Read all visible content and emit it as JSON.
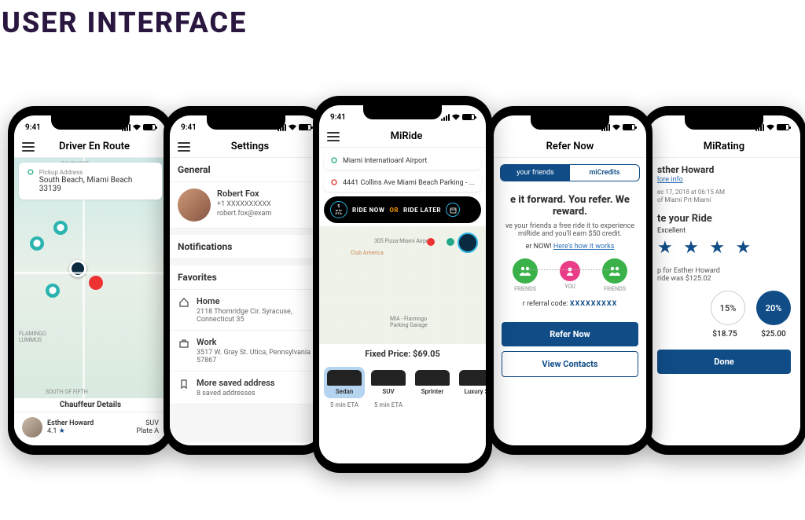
{
  "heading": "USER INTERFACE",
  "status": {
    "time": "9:41"
  },
  "p1": {
    "title": "Driver En Route",
    "pickup_label": "Pickup Address",
    "pickup_value": "South Beach, Miami Beach 33139",
    "chauffeur_title": "Chauffeur Details",
    "driver_name": "Esther Howard",
    "rating": "4.1",
    "veh": "SUV",
    "plate": "Plate A"
  },
  "p2": {
    "title": "Settings",
    "general": "General",
    "user_name": "Robert Fox",
    "user_phone": "+1 XXXXXXXXXX",
    "user_email": "robert.fox@exam",
    "notifications": "Notifications",
    "favorites": "Favorites",
    "home": "Home",
    "home_addr": "2118 Thornridge Cir. Syracuse, Connecticut 35",
    "work": "Work",
    "work_addr": "3517 W. Gray St. Utica, Pennsylvania 57867",
    "more": "More saved address",
    "more_sub": "8 saved addresses"
  },
  "p3": {
    "title": "MiRide",
    "loc1": "Miami Internatioanl Airport",
    "loc2": "4441 Collins Ave Miami Beach Parking - ...",
    "eta_num": "5",
    "eta_unit": "min ETA",
    "ride_now": "RIDE NOW",
    "or": "OR",
    "ride_later": "RIDE LATER",
    "price": "Fixed Price: $69.05",
    "cars": [
      {
        "name": "Sedan",
        "eta": "5 min ETA"
      },
      {
        "name": "SUV",
        "eta": "5 min ETA"
      },
      {
        "name": "Sprinter",
        "eta": ""
      },
      {
        "name": "Luxury S",
        "eta": ""
      }
    ]
  },
  "p4": {
    "title": "Refer Now",
    "tab1": "your friends",
    "tab2": "miCredits",
    "h": "e it forward. You refer. We reward.",
    "p": "ve your friends a free ride it to experience miRide and you'll earn $50 credit.",
    "how_pre": "er NOW! ",
    "how_link": "Here's how it works",
    "you": "YOU",
    "friends": "FRIENDS",
    "code_label": "r referral code:",
    "code": "XXXXXXXXX",
    "refer_btn": "Refer Now",
    "view_btn": "View Contacts"
  },
  "p5": {
    "title": "MiRating",
    "name": "sther Howard",
    "more": "lore info",
    "dt": "ec 17, 2018 at 06:15 AM",
    "loc": "of Miami Prt-Miami",
    "rate_h": "te your Ride",
    "exc": "Excellent",
    "tip_text1": "p for Esther Howard",
    "tip_text2": "ride was $125.02",
    "t15": "15%",
    "t20": "20%",
    "v15": "$18.75",
    "v20": "$25.00",
    "done": "Done"
  }
}
